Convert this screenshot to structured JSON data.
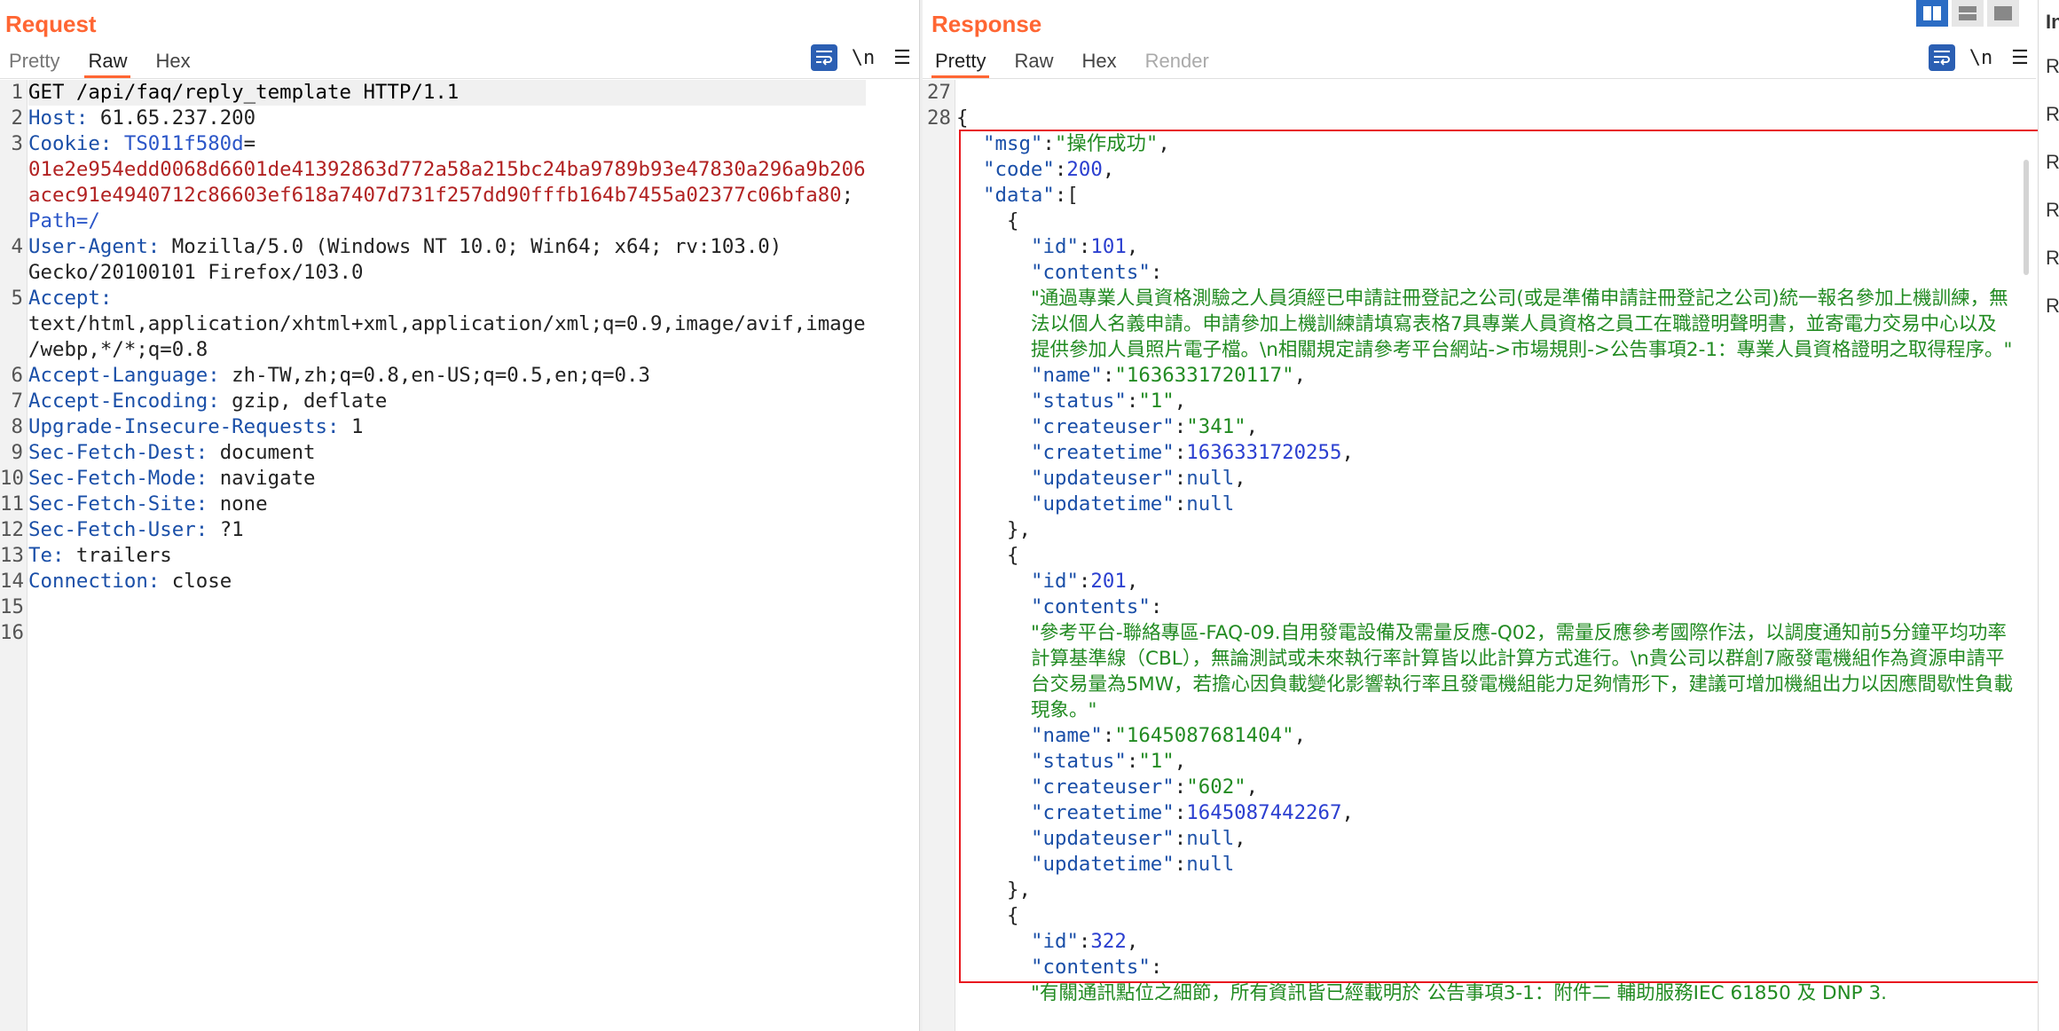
{
  "request": {
    "title": "Request",
    "tabs": [
      "Pretty",
      "Raw",
      "Hex"
    ],
    "active_tab": "Raw",
    "icons": {
      "wrap": "wrap-lines-icon",
      "newline": "\\n",
      "menu": "☰"
    },
    "lines": [
      {
        "n": "1",
        "head": "GET /api/faq/reply_template HTTP/1.1",
        "val": ""
      },
      {
        "n": "2",
        "head": "Host:",
        "val": " 61.65.237.200"
      },
      {
        "n": "3",
        "cookie_name": "TS011f580d",
        "cookie_value": [
          "01e2e954edd0068d6601de41392863d772a58a215bc24ba9789b93e47830a296a9b206",
          "acec91e4940712c86603ef618a7407d731f257dd90fffb164b7455a02377c06bfa80"
        ],
        "cookie_path": "Path=/"
      },
      {
        "n": "4",
        "head": "User-Agent:",
        "val": " Mozilla/5.0 (Windows NT 10.0; Win64; x64; rv:103.0)",
        "cont": "Gecko/20100101 Firefox/103.0"
      },
      {
        "n": "5",
        "head": "Accept:",
        "val": "",
        "cont": "text/html,application/xhtml+xml,application/xml;q=0.9,image/avif,image",
        "cont2": "/webp,*/*;q=0.8"
      },
      {
        "n": "6",
        "head": "Accept-Language:",
        "val": " zh-TW,zh;q=0.8,en-US;q=0.5,en;q=0.3"
      },
      {
        "n": "7",
        "head": "Accept-Encoding:",
        "val": " gzip, deflate"
      },
      {
        "n": "8",
        "head": "Upgrade-Insecure-Requests:",
        "val": " 1"
      },
      {
        "n": "9",
        "head": "Sec-Fetch-Dest:",
        "val": " document"
      },
      {
        "n": "10",
        "head": "Sec-Fetch-Mode:",
        "val": " navigate"
      },
      {
        "n": "11",
        "head": "Sec-Fetch-Site:",
        "val": " none"
      },
      {
        "n": "12",
        "head": "Sec-Fetch-User:",
        "val": " ?1"
      },
      {
        "n": "13",
        "head": "Te:",
        "val": " trailers"
      },
      {
        "n": "14",
        "head": "Connection:",
        "val": " close"
      },
      {
        "n": "15",
        "head": "",
        "val": ""
      },
      {
        "n": "16",
        "head": "",
        "val": ""
      }
    ]
  },
  "response": {
    "title": "Response",
    "tabs": [
      "Pretty",
      "Raw",
      "Hex",
      "Render"
    ],
    "active_tab": "Pretty",
    "line_27": "27",
    "line_28": "28",
    "open_brace": "{",
    "msg_key": "\"msg\"",
    "msg_val": "\"操作成功\"",
    "code_key": "\"code\"",
    "code_val": "200",
    "data_key": "\"data\"",
    "items": [
      {
        "id": "101",
        "contents": "\"通過專業人員資格測驗之人員須經已申請註冊登記之公司(或是準備申請註冊登記之公司)統一報名參加上機訓練，無法以個人名義申請。申請參加上機訓練請填寫表格7具專業人員資格之員工在職證明聲明書，並寄電力交易中心以及提供參加人員照片電子檔。\\n相關規定請參考平台網站->市場規則->公告事項2-1：專業人員資格證明之取得程序。\"",
        "name": "\"1636331720117\"",
        "status": "\"1\"",
        "createuser": "\"341\"",
        "createtime": "1636331720255",
        "updateuser": "null",
        "updatetime": "null"
      },
      {
        "id": "201",
        "contents": "\"參考平台-聯絡專區-FAQ-09.自用發電設備及需量反應-Q02，需量反應參考國際作法，以調度通知前5分鐘平均功率計算基準線（CBL），無論測試或未來執行率計算皆以此計算方式進行。\\n貴公司以群創7廠發電機組作為資源申請平台交易量為5MW，若擔心因負載變化影響執行率且發電機組能力足夠情形下，建議可增加機組出力以因應間歇性負載現象。\"",
        "name": "\"1645087681404\"",
        "status": "\"1\"",
        "createuser": "\"602\"",
        "createtime": "1645087442267",
        "updateuser": "null",
        "updatetime": "null"
      },
      {
        "id": "322",
        "contents": "\"有關通訊點位之細節，所有資訊皆已經載明於 公告事項3-1：附件二 輔助服務IEC 61850 及 DNP 3."
      }
    ]
  },
  "side_items": [
    "R",
    "R",
    "R",
    "R",
    "R",
    "R"
  ],
  "side_top": "In"
}
